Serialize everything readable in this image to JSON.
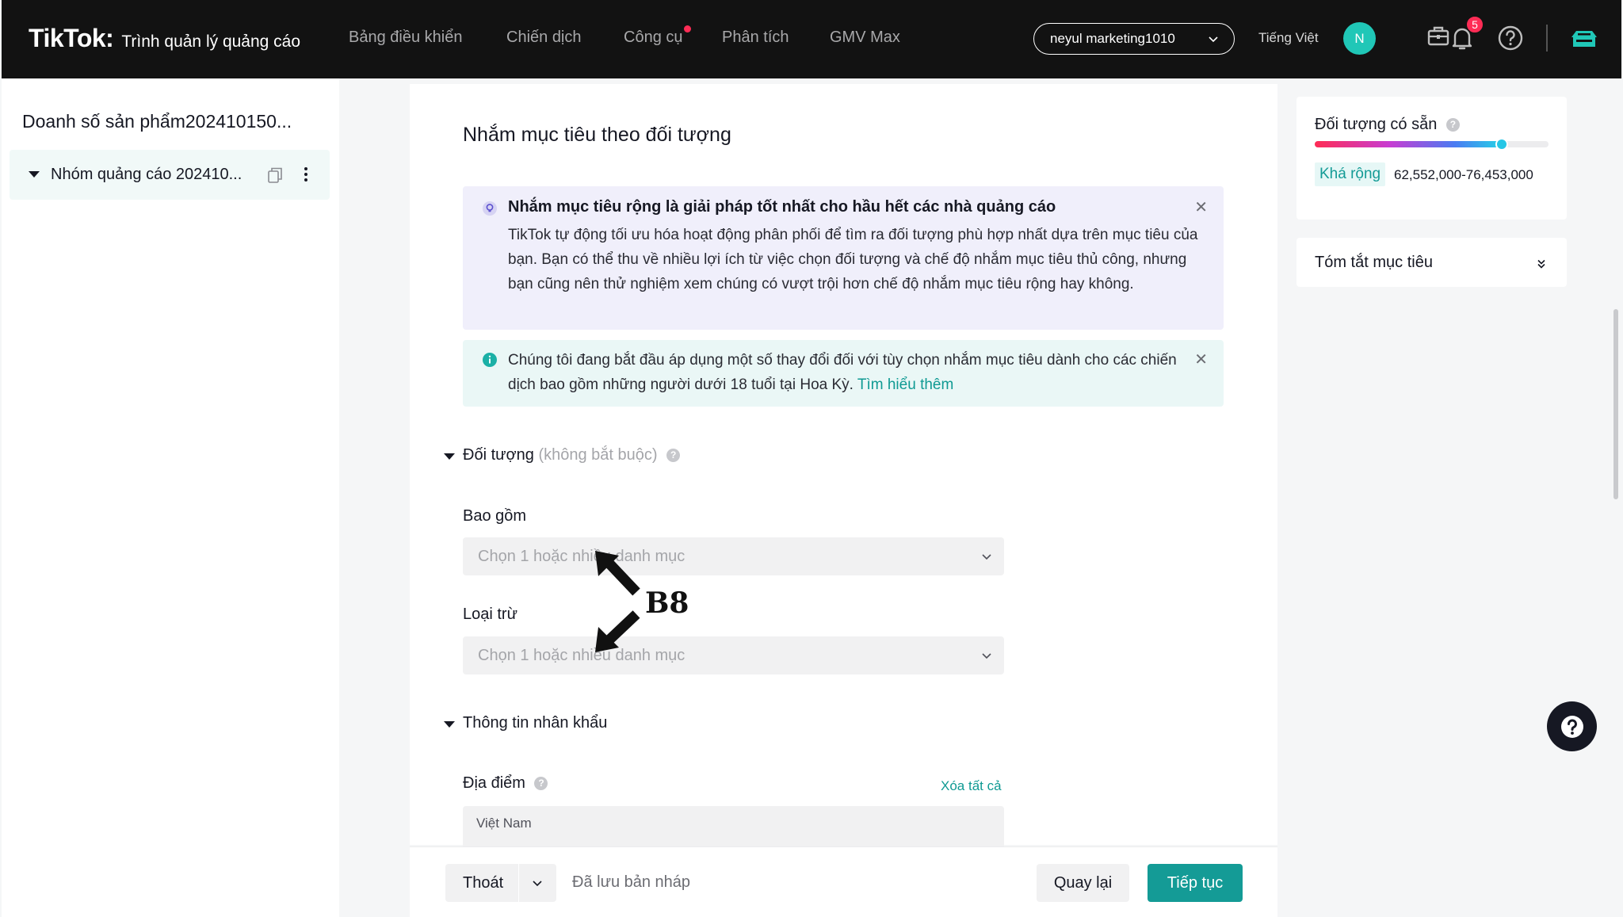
{
  "topnav": {
    "logo_brand": "TikTok",
    "logo_colon": ":",
    "logo_sub": "Trình quản lý quảng cáo",
    "items": [
      {
        "label": "Bảng điều khiển"
      },
      {
        "label": "Chiến dịch"
      },
      {
        "label": "Công cụ"
      },
      {
        "label": "Phân tích"
      },
      {
        "label": "GMV Max"
      }
    ],
    "account": "neyul marketing1010",
    "language": "Tiếng Việt",
    "avatar_initial": "N",
    "notification_count": "5"
  },
  "sidebar": {
    "campaign_title": "Doanh số sản phẩm202410150...",
    "adgroup_label": "Nhóm quảng cáo 202410..."
  },
  "main": {
    "section_title": "Nhắm mục tiêu theo đối tượng",
    "banner_broad": {
      "heading": "Nhắm mục tiêu rộng là giải pháp tốt nhất cho hầu hết các nhà quảng cáo",
      "body": "TikTok tự động tối ưu hóa hoạt động phân phối để tìm ra đối tượng phù hợp nhất dựa trên mục tiêu của bạn. Bạn có thể thu về nhiều lợi ích từ việc chọn đối tượng và chế độ nhắm mục tiêu thủ công, nhưng bạn cũng nên thử nghiệm xem chúng có vượt trội hơn chế độ nhắm mục tiêu rộng hay không."
    },
    "banner_notice": {
      "text": "Chúng tôi đang bắt đầu áp dụng một số thay đổi đối với tùy chọn nhắm mục tiêu dành cho các chiến dịch bao gồm những người dưới 18 tuổi tại Hoa Kỳ.",
      "link": "Tìm hiểu thêm"
    },
    "audience": {
      "title": "Đối tượng",
      "optional": "(không bắt buộc)",
      "include_label": "Bao gồm",
      "include_placeholder": "Chọn 1 hoặc nhiều danh mục",
      "exclude_label": "Loại trừ",
      "exclude_placeholder": "Chọn 1 hoặc nhiều danh mục"
    },
    "demographics": {
      "title": "Thông tin nhân khẩu",
      "location_label": "Địa điểm",
      "clear_all": "Xóa tất cả",
      "location_value": "Việt Nam"
    },
    "annotation": "B8"
  },
  "footer": {
    "exit": "Thoát",
    "draft_status": "Đã lưu bản nháp",
    "back": "Quay lại",
    "next": "Tiếp tục"
  },
  "right": {
    "audience_size_title": "Đối tượng có sẵn",
    "audience_size_fraction": 0.8,
    "breadth_tag": "Khá rộng",
    "range": "62,552,000-76,453,000",
    "summary_title": "Tóm tắt mục tiêu"
  },
  "colors": {
    "accent": "#149b96",
    "nav_bg": "#121212",
    "badge": "#fe2c55"
  }
}
